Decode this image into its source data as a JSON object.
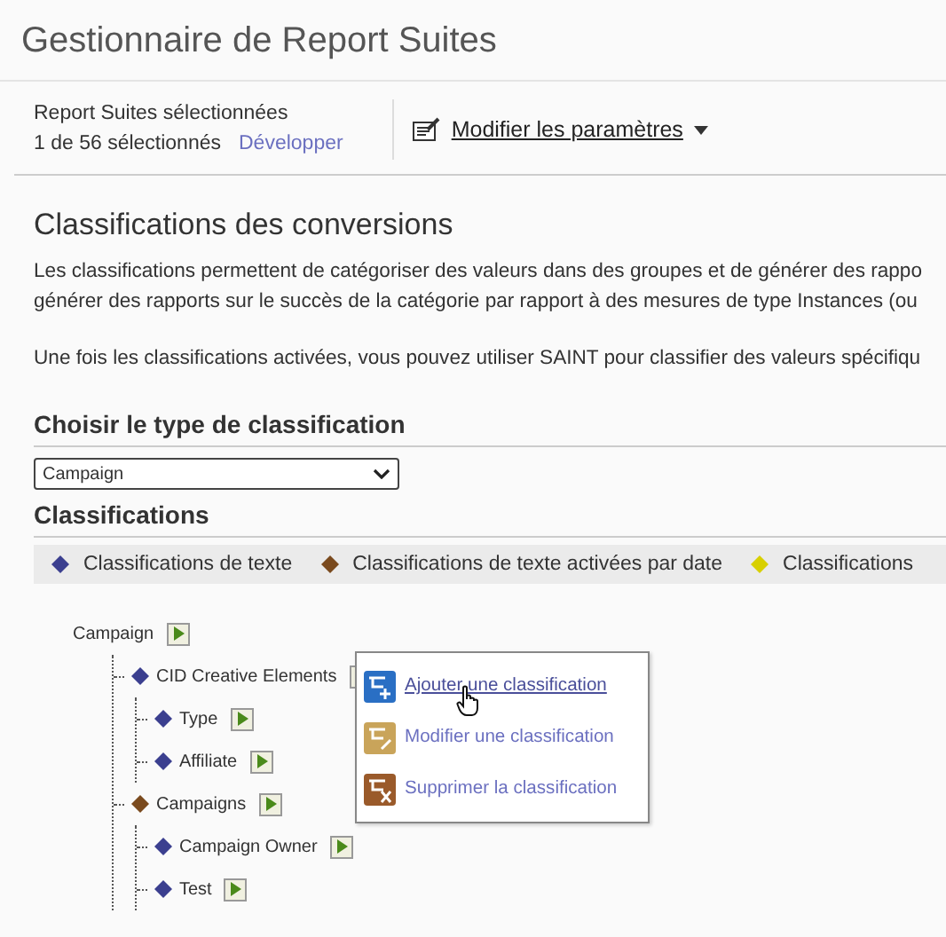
{
  "page_title": "Gestionnaire de Report Suites",
  "selection": {
    "label": "Report Suites sélectionnées",
    "count": "1 de 56 sélectionnés",
    "expand_link": "Développer"
  },
  "settings_menu": {
    "label": "Modifier les paramètres"
  },
  "section_title": "Classifications des conversions",
  "paragraphs": [
    "Les classifications permettent de catégoriser des valeurs dans des groupes et de générer des rappo",
    "générer des rapports sur le succès de la catégorie par rapport à des mesures de type Instances (ou",
    "Une fois les classifications activées, vous pouvez utiliser SAINT pour classifier des valeurs spécifiqu"
  ],
  "type_heading": "Choisir le type de classification",
  "type_select": {
    "value": "Campaign"
  },
  "classifications_heading": "Classifications",
  "legend": [
    {
      "label": "Classifications de texte",
      "color": "#3b3f8f"
    },
    {
      "label": "Classifications de texte activées par date",
      "color": "#7a4a1e"
    },
    {
      "label": "Classifications",
      "color": "#d8d000"
    }
  ],
  "tree": {
    "label": "Campaign",
    "children": [
      {
        "label": "CID Creative Elements",
        "color": "#3b3f8f",
        "children": [
          {
            "label": "Type",
            "color": "#3b3f8f"
          },
          {
            "label": "Affiliate",
            "color": "#3b3f8f"
          }
        ]
      },
      {
        "label": "Campaigns",
        "color": "#7a4a1e",
        "children": [
          {
            "label": "Campaign Owner",
            "color": "#3b3f8f"
          },
          {
            "label": "Test",
            "color": "#3b3f8f"
          }
        ]
      }
    ]
  },
  "context_menu": [
    {
      "kind": "add",
      "label": "Ajouter une classification",
      "hovered": true
    },
    {
      "kind": "edit",
      "label": "Modifier une classification",
      "hovered": false
    },
    {
      "kind": "delete",
      "label": "Supprimer la classification",
      "hovered": false
    }
  ]
}
